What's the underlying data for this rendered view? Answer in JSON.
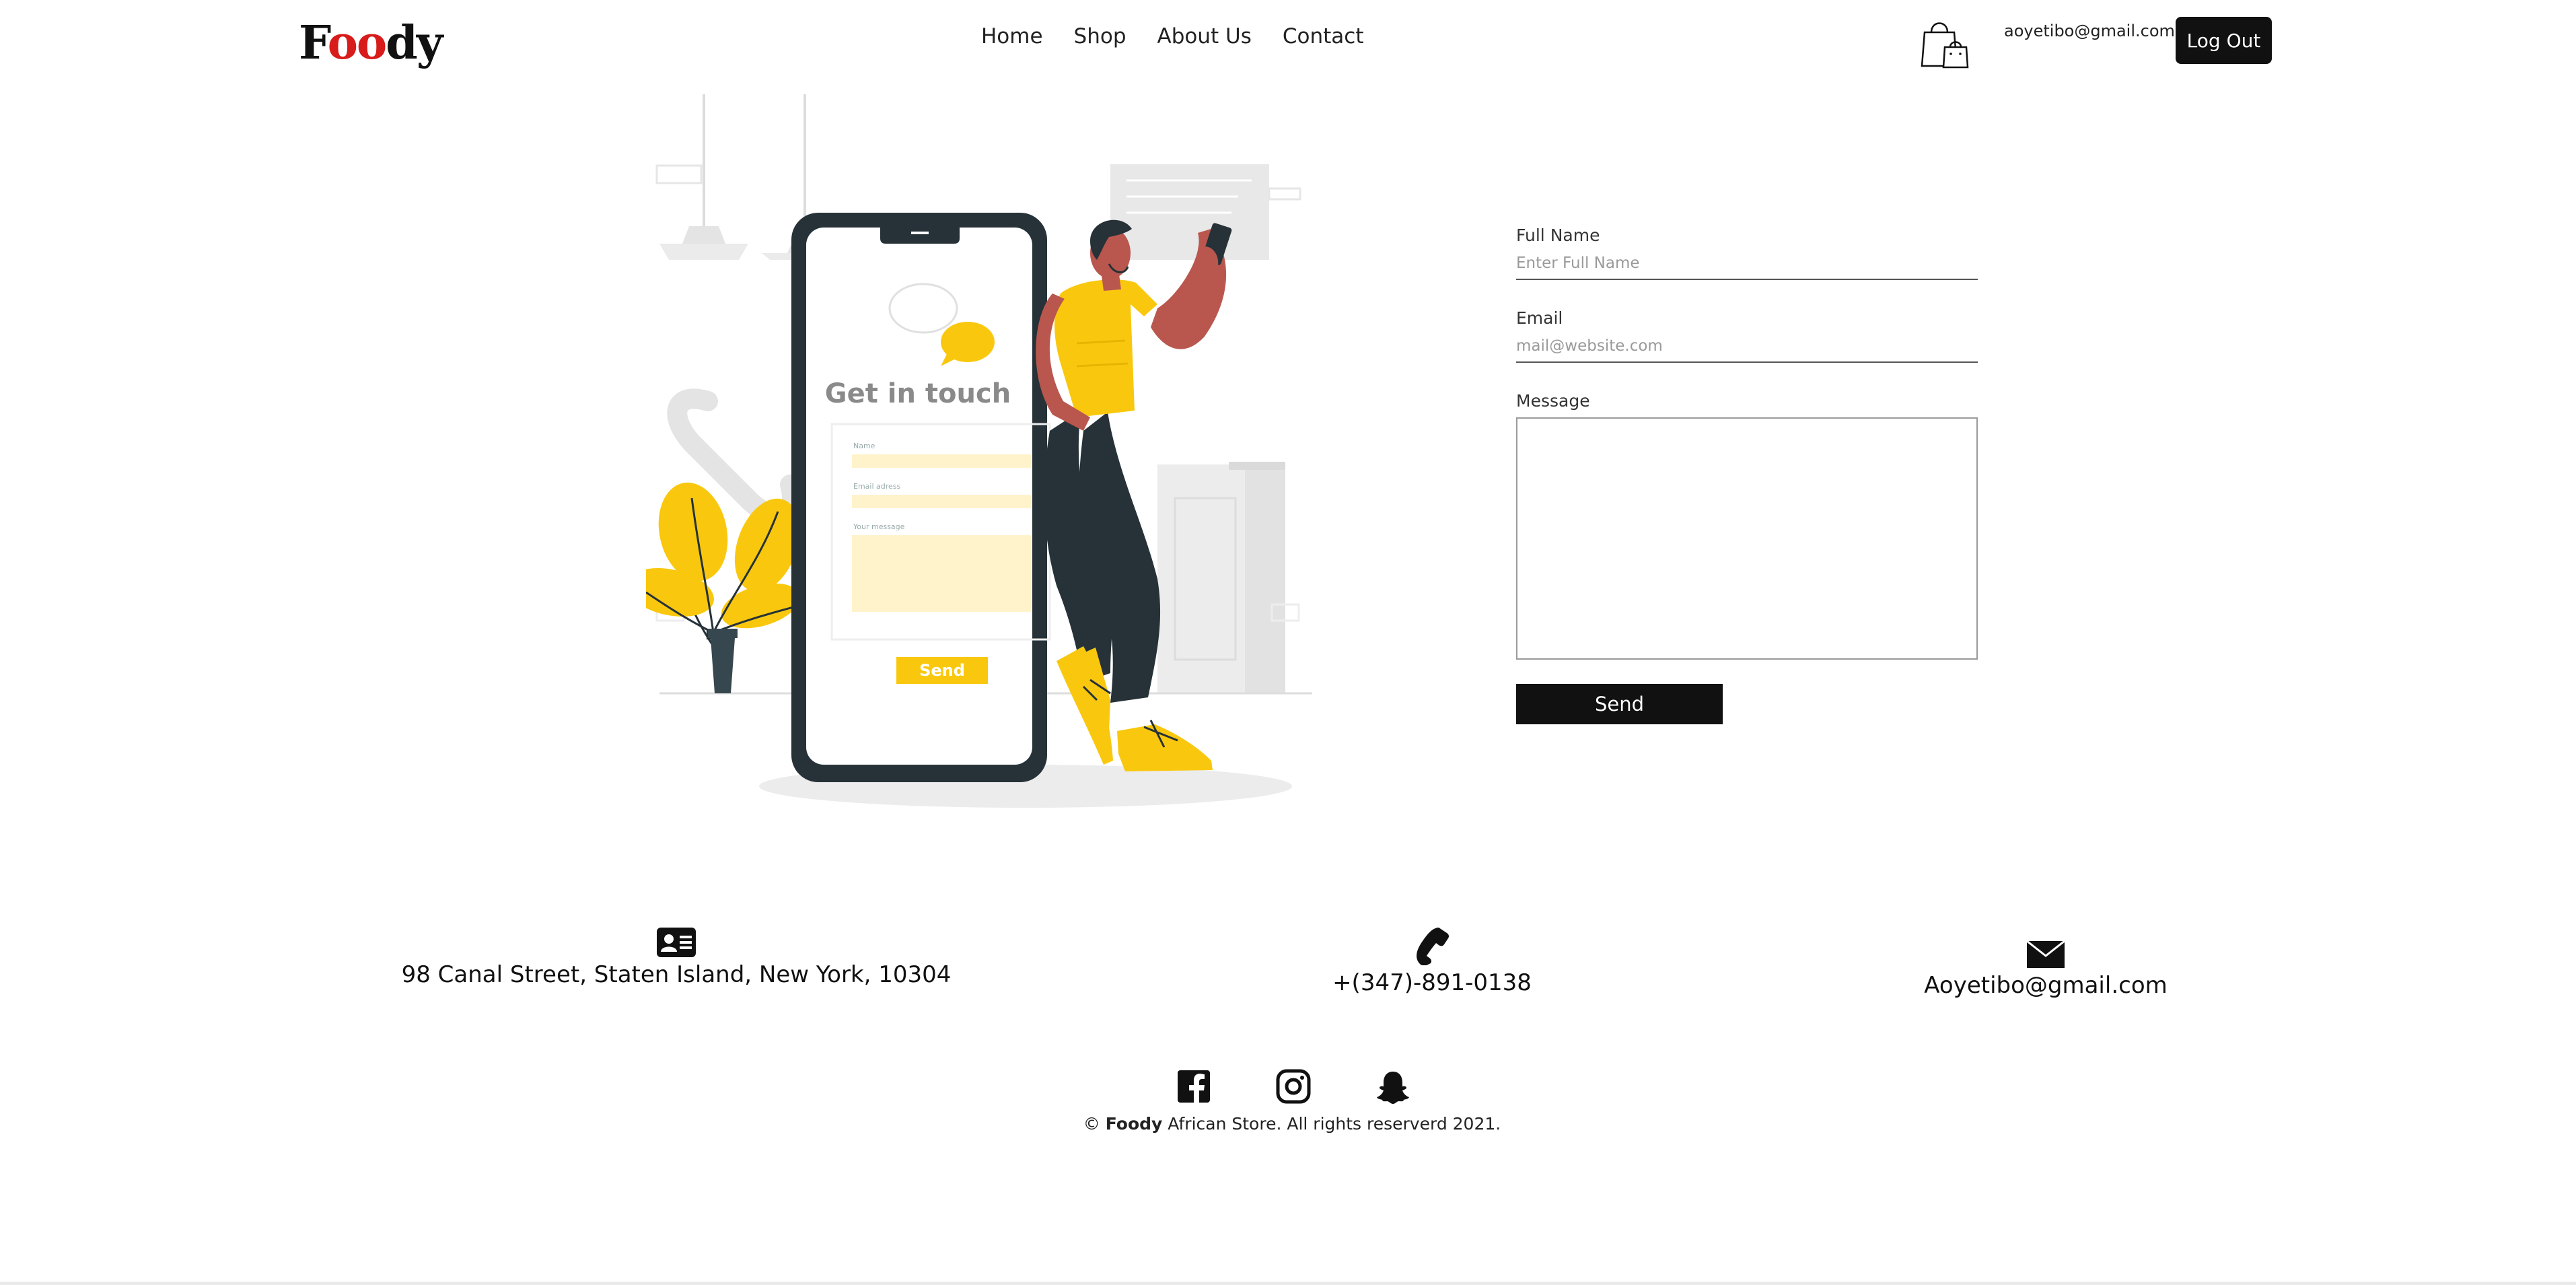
{
  "brand": {
    "logo_text": "Foody"
  },
  "nav": {
    "items": [
      "Home",
      "Shop",
      "About Us",
      "Contact"
    ]
  },
  "header": {
    "cart_icon": "shopping-bag-icon",
    "user_email": "aoyetibo@gmail.com",
    "logout_label": "Log Out"
  },
  "illustration": {
    "title": "Get in touch",
    "name_label": "Name",
    "email_label": "Email adress",
    "message_label": "Your message",
    "send_label": "Send",
    "accent_color": "#F9C80E",
    "dark_color": "#263238"
  },
  "form": {
    "full_name_label": "Full Name",
    "full_name_placeholder": "Enter Full Name",
    "email_label": "Email",
    "email_placeholder": "mail@website.com",
    "message_label": "Message",
    "send_label": "Send"
  },
  "contact": {
    "address_icon": "id-card-icon",
    "address": "98 Canal Street, Staten Island, New York, 10304",
    "phone_icon": "phone-icon",
    "phone": "+(347)-891-0138",
    "email_icon": "envelope-icon",
    "email": "Aoyetibo@gmail.com"
  },
  "social": {
    "icons": [
      "facebook-icon",
      "instagram-icon",
      "snapchat-icon"
    ]
  },
  "footer": {
    "copyright_symbol": "©",
    "brand": "Foody",
    "copyright_text": "African Store. All rights reserverd 2021."
  }
}
